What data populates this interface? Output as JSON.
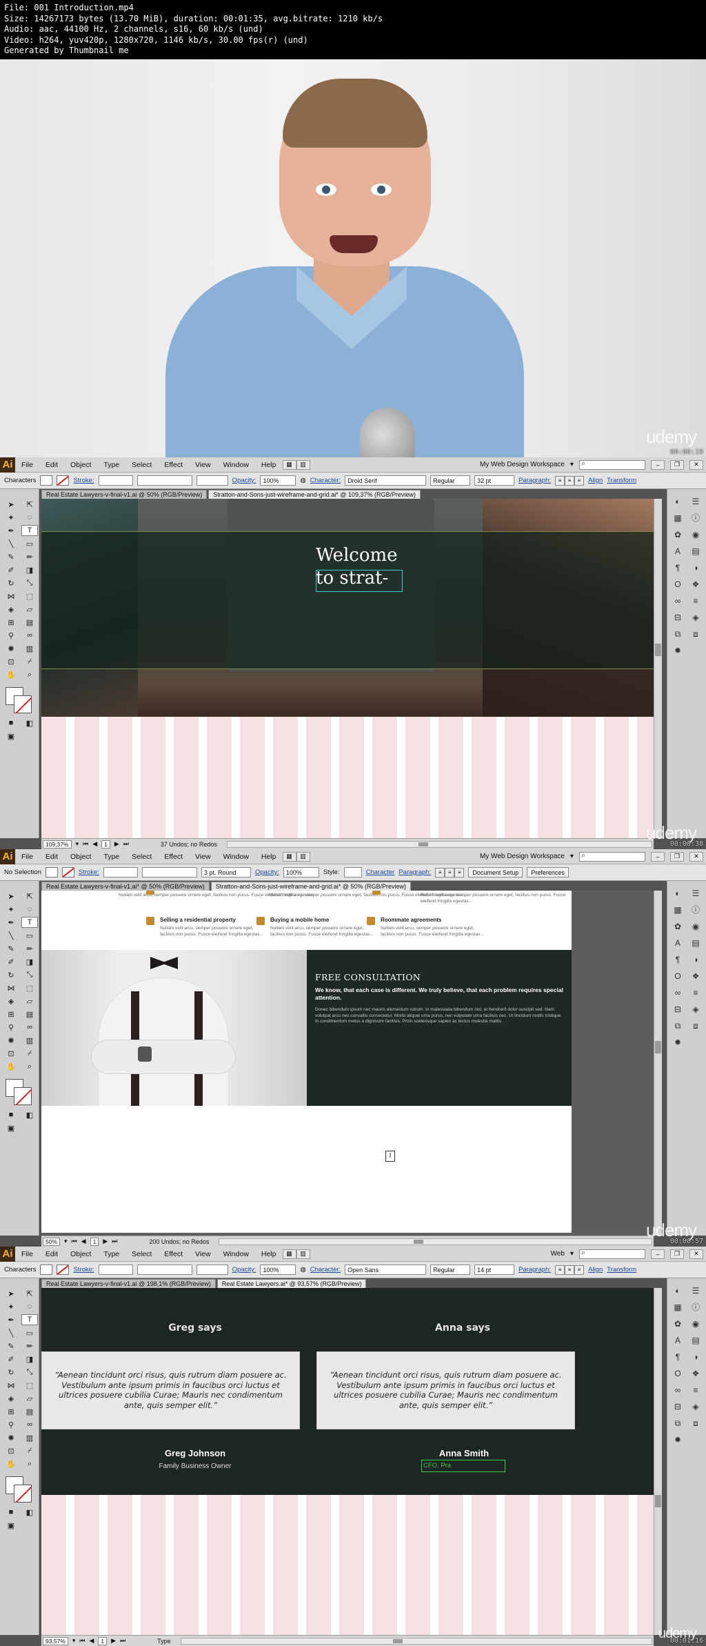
{
  "header": {
    "lines": [
      "File: 001 Introduction.mp4",
      "Size: 14267173 bytes (13.70 MiB), duration: 00:01:35, avg.bitrate: 1210 kb/s",
      "Audio: aac, 44100 Hz, 2 channels, s16, 60 kb/s (und)",
      "Video: h264, yuv420p, 1280x720, 1146 kb/s, 30.00 fps(r) (und)",
      "Generated by Thumbnail me"
    ]
  },
  "frame1": {
    "watermark": "udemy",
    "timestamp": "00:00:19"
  },
  "app": {
    "logo": "Ai",
    "menu": [
      "File",
      "Edit",
      "Object",
      "Type",
      "Select",
      "Effect",
      "View",
      "Window",
      "Help"
    ],
    "colors": {
      "menubar": "#d6d6d6",
      "panel": "#cfcfcf",
      "accent_link": "#1a4a9a",
      "artboard_grid": "#f5e1e4",
      "text_selection": "#3ed0d0"
    }
  },
  "frame2": {
    "workspace": "My Web Design Workspace",
    "control": {
      "label": "Characters",
      "stroke_label": "Stroke:",
      "opacity_label": "Opacity:",
      "opacity": "100%",
      "character_label": "Character:",
      "font": "Droid Serif",
      "style": "Regular",
      "size": "32 pt",
      "paragraph_label": "Paragraph:",
      "align_label": "Align",
      "transform_label": "Transform"
    },
    "tabs": [
      "Real Estate Lawyers-v-final-v1.ai @ 50% (RGB/Preview)",
      "Stratton-and-Sons-just-wireframe-and-grid.ai* @ 109,37% (RGB/Preview)"
    ],
    "welcome": [
      "Welcome",
      "to strat-"
    ],
    "status": {
      "zoom": "109,37%",
      "page": "1",
      "info": "37 Undos; no Redos"
    },
    "watermark": "udemy",
    "timestamp": "00:00:38"
  },
  "frame3": {
    "workspace": "My Web Design Workspace",
    "control": {
      "label": "No Selection",
      "stroke_label": "Stroke:",
      "stroke_profile": "3 pt. Round",
      "opacity_label": "Opacity:",
      "opacity": "100%",
      "style_label": "Style:",
      "character_label": "Character",
      "paragraph_label": "Paragraph:",
      "doc_setup": "Document Setup",
      "preferences": "Preferences"
    },
    "tabs": [
      "Real Estate Lawyers-v-final-v1.ai* @ 50% (RGB/Preview)",
      "Stratton-and-Sons-just-wireframe-and-grid.ai* @ 50% (RGB/Preview)"
    ],
    "top_text": [
      "Nullam velit arcu, semper posuere ornare eget, facilisis non purus. Fusce eleifend fringilla egestas...",
      "Nullam velit arcu, semper posuere ornare eget, facilisis non purus. Fusce eleifend fringilla egestas...",
      "Nullam velit arcu, semper posuere ornare eget, facilisis non purus. Fusce eleifend fringilla egestas..."
    ],
    "services": [
      {
        "title": "Selling a residential property",
        "text": "Nullam velit arcu, semper posuere ornare eget, facilisis non purus. Fusce eleifend fringilla egestas..."
      },
      {
        "title": "Buying a mobile home",
        "text": "Nullam velit arcu, semper posuere ornare eget, facilisis non purus. Fusce eleifend fringilla egestas..."
      },
      {
        "title": "Roommate agreements",
        "text": "Nullam velit arcu, semper posuere ornare eget, facilisis non purus. Fusce eleifend fringilla egestas..."
      }
    ],
    "consult": {
      "title": "FREE CONSULTATION",
      "lead": "We know, that each case is different. We truly believe, that each problem requires special attention.",
      "body": "Donec bibendum ipsum nec mauris elementum rutrum. In malesuada bibendum nisl, et hendrerit dolor suscipit sed. Nam volutpat arcu nec convallis consectetur. Morbi aliquet urna purus, nec vulputate urna facilisis nec. Ut tincidunt mollis tristique. In condimentum metus a dignissim facilisis. Proin scelerisque sapien ac lectus molestie mattis."
    },
    "status": {
      "zoom": "50%",
      "page": "1",
      "info": "200 Undos; no Redos"
    },
    "watermark": "udemy",
    "timestamp": "00:00:57"
  },
  "frame4": {
    "workspace": "Web",
    "control": {
      "label": "Characters",
      "stroke_label": "Stroke:",
      "opacity_label": "Opacity:",
      "opacity": "100%",
      "character_label": "Character:",
      "font": "Open Sans",
      "style": "Regular",
      "size": "14 pt",
      "paragraph_label": "Paragraph:",
      "align_label": "Align",
      "transform_label": "Transform"
    },
    "tabs": [
      "Real Estate Lawyers-v-final-v1.ai @ 198,1% (RGB/Preview)",
      "Real Estate Lawyers.ai* @ 93,57% (RGB/Preview)"
    ],
    "testimonials": [
      {
        "heading": "Greg says",
        "quote": "“Aenean tincidunt orci risus, quis rutrum diam posuere ac. Vestibulum ante ipsum primis in faucibus orci luctus et ultrices posuere cubilia Curae; Mauris nec condimentum ante, quis semper elit.”",
        "name": "Greg Johnson",
        "role": "Family Business Owner"
      },
      {
        "heading": "Anna says",
        "quote": "“Aenean tincidunt orci risus, quis rutrum diam posuere ac. Vestibulum ante ipsum primis in faucibus orci luctus et ultrices posuere cubilia Curae; Mauris nec condimentum ante, quis semper elit.”",
        "name": "Anna Smith",
        "role": "CFO, Pra"
      }
    ],
    "status": {
      "zoom": "93,57%",
      "page": "1",
      "info": "Type"
    },
    "watermark": "udemy",
    "timestamp": "00:01:16"
  }
}
